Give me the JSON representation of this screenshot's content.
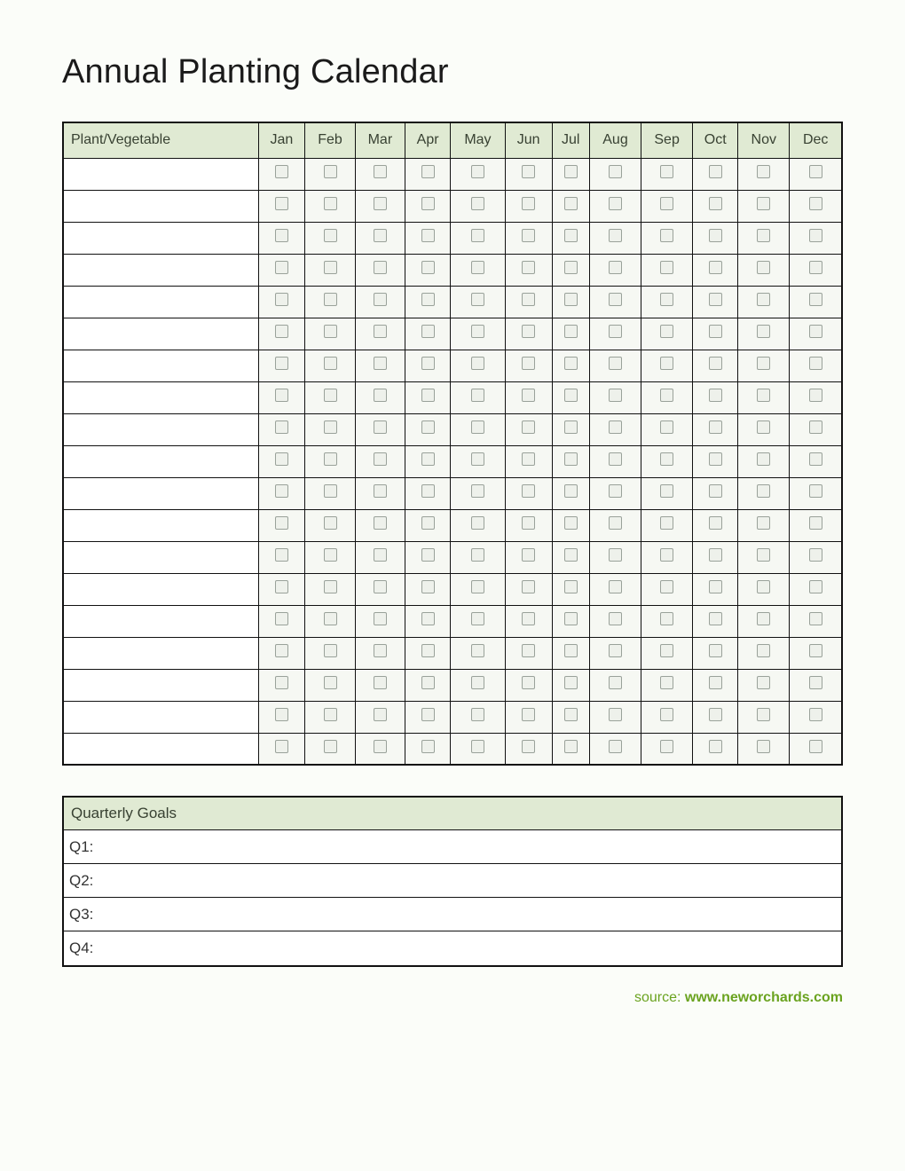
{
  "title": "Annual Planting Calendar",
  "table_header": {
    "plant_label": "Plant/Vegetable",
    "months": [
      "Jan",
      "Feb",
      "Mar",
      "Apr",
      "May",
      "Jun",
      "Jul",
      "Aug",
      "Sep",
      "Oct",
      "Nov",
      "Dec"
    ]
  },
  "rows": [
    {
      "name": "",
      "months": [
        false,
        false,
        false,
        false,
        false,
        false,
        false,
        false,
        false,
        false,
        false,
        false
      ]
    },
    {
      "name": "",
      "months": [
        false,
        false,
        false,
        false,
        false,
        false,
        false,
        false,
        false,
        false,
        false,
        false
      ]
    },
    {
      "name": "",
      "months": [
        false,
        false,
        false,
        false,
        false,
        false,
        false,
        false,
        false,
        false,
        false,
        false
      ]
    },
    {
      "name": "",
      "months": [
        false,
        false,
        false,
        false,
        false,
        false,
        false,
        false,
        false,
        false,
        false,
        false
      ]
    },
    {
      "name": "",
      "months": [
        false,
        false,
        false,
        false,
        false,
        false,
        false,
        false,
        false,
        false,
        false,
        false
      ]
    },
    {
      "name": "",
      "months": [
        false,
        false,
        false,
        false,
        false,
        false,
        false,
        false,
        false,
        false,
        false,
        false
      ]
    },
    {
      "name": "",
      "months": [
        false,
        false,
        false,
        false,
        false,
        false,
        false,
        false,
        false,
        false,
        false,
        false
      ]
    },
    {
      "name": "",
      "months": [
        false,
        false,
        false,
        false,
        false,
        false,
        false,
        false,
        false,
        false,
        false,
        false
      ]
    },
    {
      "name": "",
      "months": [
        false,
        false,
        false,
        false,
        false,
        false,
        false,
        false,
        false,
        false,
        false,
        false
      ]
    },
    {
      "name": "",
      "months": [
        false,
        false,
        false,
        false,
        false,
        false,
        false,
        false,
        false,
        false,
        false,
        false
      ]
    },
    {
      "name": "",
      "months": [
        false,
        false,
        false,
        false,
        false,
        false,
        false,
        false,
        false,
        false,
        false,
        false
      ]
    },
    {
      "name": "",
      "months": [
        false,
        false,
        false,
        false,
        false,
        false,
        false,
        false,
        false,
        false,
        false,
        false
      ]
    },
    {
      "name": "",
      "months": [
        false,
        false,
        false,
        false,
        false,
        false,
        false,
        false,
        false,
        false,
        false,
        false
      ]
    },
    {
      "name": "",
      "months": [
        false,
        false,
        false,
        false,
        false,
        false,
        false,
        false,
        false,
        false,
        false,
        false
      ]
    },
    {
      "name": "",
      "months": [
        false,
        false,
        false,
        false,
        false,
        false,
        false,
        false,
        false,
        false,
        false,
        false
      ]
    },
    {
      "name": "",
      "months": [
        false,
        false,
        false,
        false,
        false,
        false,
        false,
        false,
        false,
        false,
        false,
        false
      ]
    },
    {
      "name": "",
      "months": [
        false,
        false,
        false,
        false,
        false,
        false,
        false,
        false,
        false,
        false,
        false,
        false
      ]
    },
    {
      "name": "",
      "months": [
        false,
        false,
        false,
        false,
        false,
        false,
        false,
        false,
        false,
        false,
        false,
        false
      ]
    },
    {
      "name": "",
      "months": [
        false,
        false,
        false,
        false,
        false,
        false,
        false,
        false,
        false,
        false,
        false,
        false
      ]
    }
  ],
  "goals": {
    "header": "Quarterly Goals",
    "items": [
      {
        "label": "Q1:",
        "value": ""
      },
      {
        "label": "Q2:",
        "value": ""
      },
      {
        "label": "Q3:",
        "value": ""
      },
      {
        "label": "Q4:",
        "value": ""
      }
    ]
  },
  "source": {
    "prefix": "source: ",
    "site": "www.neworchards.com"
  }
}
